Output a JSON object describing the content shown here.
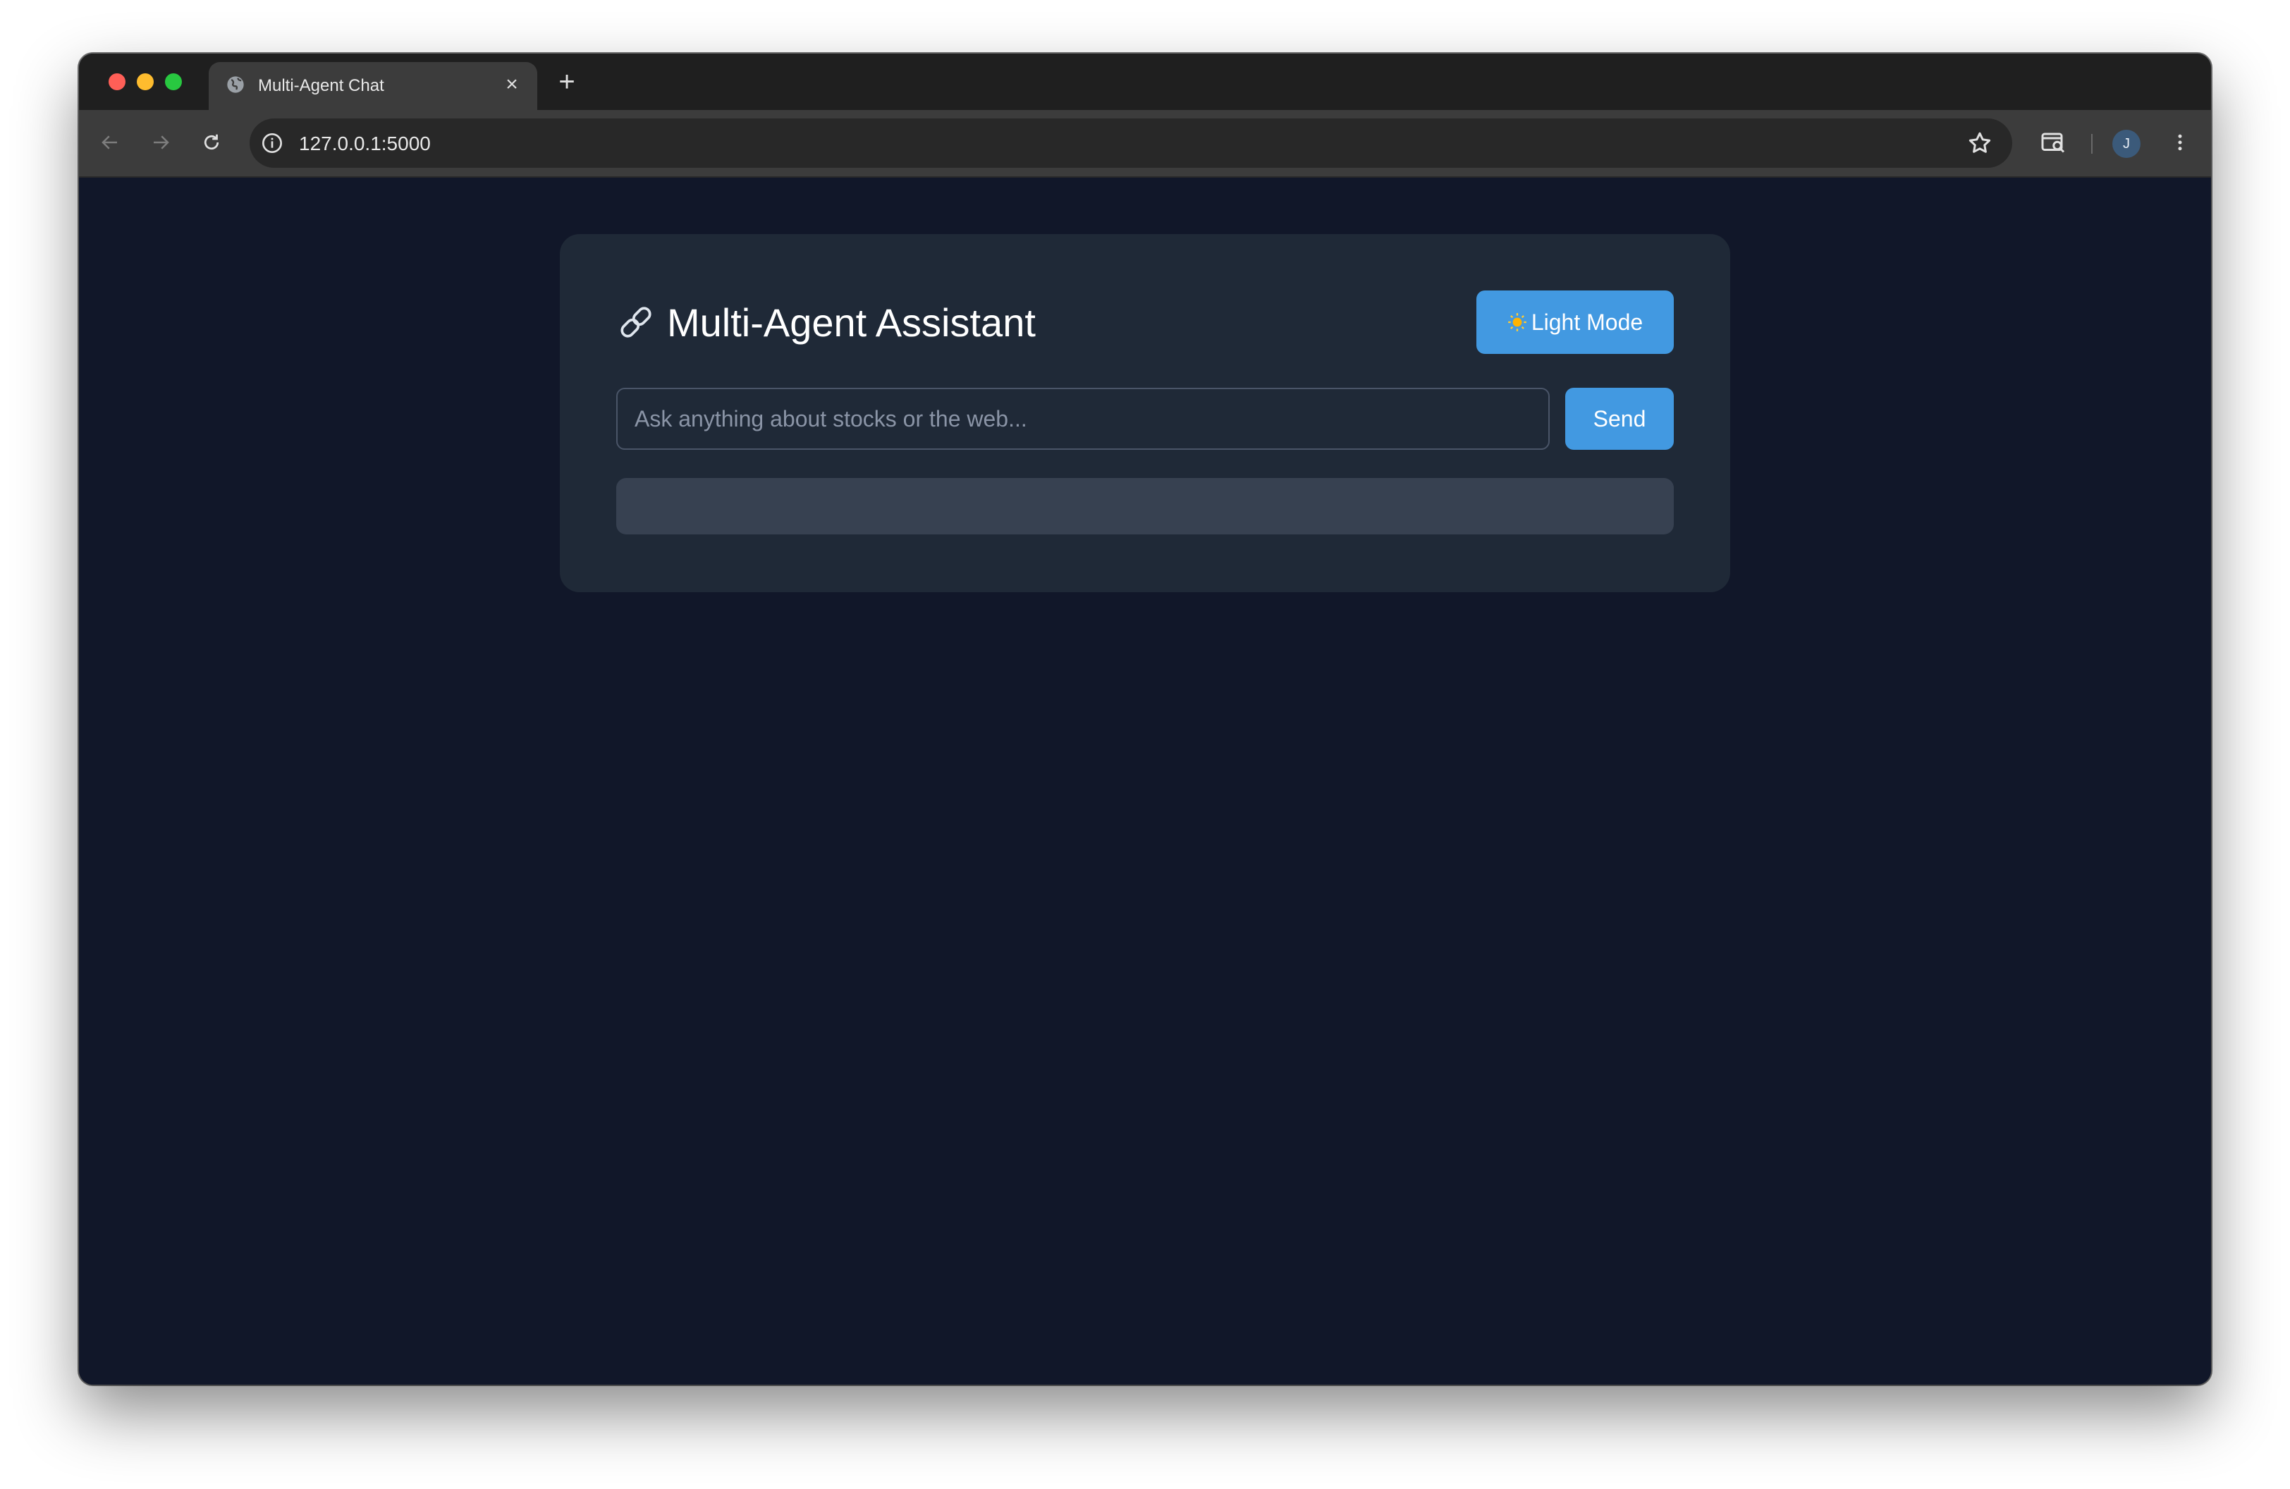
{
  "browser": {
    "tab": {
      "title": "Multi-Agent Chat",
      "favicon": "globe-icon",
      "close": "×"
    },
    "new_tab": "+",
    "url": "127.0.0.1:5000",
    "profile_initial": "J"
  },
  "app": {
    "title": "Multi-Agent Assistant",
    "title_icon": "link-icon",
    "theme_toggle": {
      "label": "Light Mode",
      "icon": "sun-icon"
    },
    "query": {
      "placeholder": "Ask anything about stocks or the web...",
      "value": ""
    },
    "send_label": "Send",
    "response": ""
  },
  "colors": {
    "page_background": "#111729",
    "card_background": "#1f2937",
    "accent": "#4299e1",
    "response_background": "#374151"
  }
}
